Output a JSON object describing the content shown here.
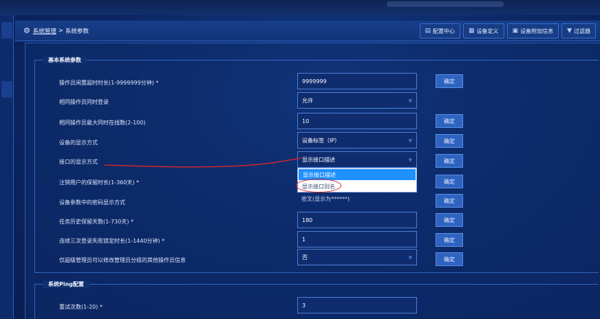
{
  "breadcrumb": {
    "root": "系统管理",
    "separator": ">",
    "current": "系统参数"
  },
  "toolbar": {
    "config_center": "配置中心",
    "device_definition": "设备定义",
    "device_extra_info": "设备附加信息",
    "filter": "过滤器"
  },
  "sections": {
    "basic": "基本系统参数",
    "ping": "系统Ping配置"
  },
  "rows": [
    {
      "label": "操作员闲置超时时长(1-9999999分钟) *",
      "value": "9999999",
      "type": "input",
      "confirm": "确定"
    },
    {
      "label": "相同操作员同时登录",
      "value": "允许",
      "type": "select"
    },
    {
      "label": "相同操作员最大同时在线数(2-100)",
      "value": "10",
      "type": "input",
      "confirm": "确定"
    },
    {
      "label": "设备的显示方式",
      "value": "设备标签（IP）",
      "type": "select",
      "confirm": "确定"
    },
    {
      "label": "接口的显示方式",
      "value": "显示接口描述",
      "type": "select",
      "confirm": "确定"
    },
    {
      "label": "注销用户的保留时长(1-360天) *",
      "value": "",
      "type": "input",
      "confirm": "确定"
    },
    {
      "label": "设备参数中的密码显示方式",
      "value": "密文(显示为******)",
      "type": "select",
      "confirm": "确定"
    },
    {
      "label": "任务历史保留天数(1-730天) *",
      "value": "180",
      "type": "input",
      "confirm": "确定"
    },
    {
      "label": "连续三次登录失败锁定时长(1-1440分钟) *",
      "value": "1",
      "type": "input",
      "confirm": "确定"
    },
    {
      "label": "仅超级管理员可以修改管理员分组的其他操作员信息",
      "value": "否",
      "type": "select",
      "confirm": "确定"
    }
  ],
  "ping_rows": [
    {
      "label": "重试次数(1-20) *",
      "value": "3"
    }
  ],
  "dropdown": {
    "options": [
      "显示接口描述",
      "显示接口别名"
    ],
    "selected": "显示接口描述"
  },
  "colors": {
    "accent": "#2e63c0",
    "highlight": "#1e90ff",
    "annotation": "#d0262e"
  }
}
